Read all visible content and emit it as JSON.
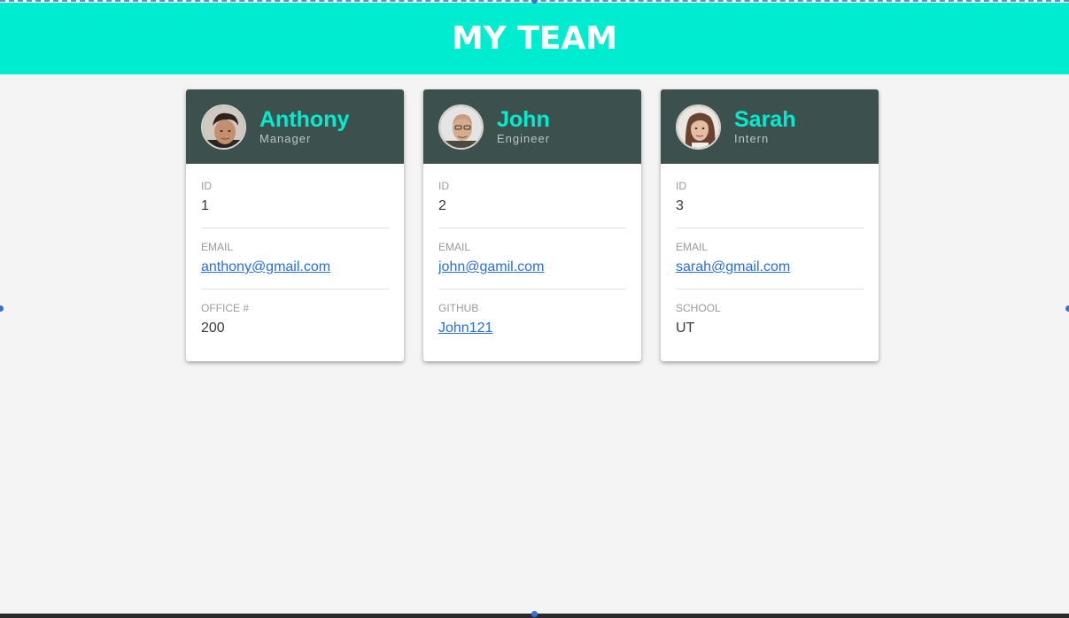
{
  "header": {
    "title": "MY TEAM"
  },
  "team": [
    {
      "name": "Anthony",
      "role": "Manager",
      "fields": [
        {
          "label": "ID",
          "value": "1",
          "link": false
        },
        {
          "label": "EMAIL",
          "value": "anthony@gmail.com",
          "link": true
        },
        {
          "label": "OFFICE #",
          "value": "200",
          "link": false
        }
      ]
    },
    {
      "name": "John",
      "role": "Engineer",
      "fields": [
        {
          "label": "ID",
          "value": "2",
          "link": false
        },
        {
          "label": "EMAIL",
          "value": "john@gamil.com",
          "link": true
        },
        {
          "label": "GITHUB",
          "value": "John121",
          "link": true
        }
      ]
    },
    {
      "name": "Sarah",
      "role": "Intern",
      "fields": [
        {
          "label": "ID",
          "value": "3",
          "link": false
        },
        {
          "label": "EMAIL",
          "value": "sarah@gmail.com",
          "link": true
        },
        {
          "label": "SCHOOL",
          "value": "UT",
          "link": false
        }
      ]
    }
  ],
  "colors": {
    "header_bg": "#00ecd0",
    "card_head_bg": "#3c514e",
    "name_color": "#00ecd0",
    "link_color": "#2a6fd6"
  }
}
